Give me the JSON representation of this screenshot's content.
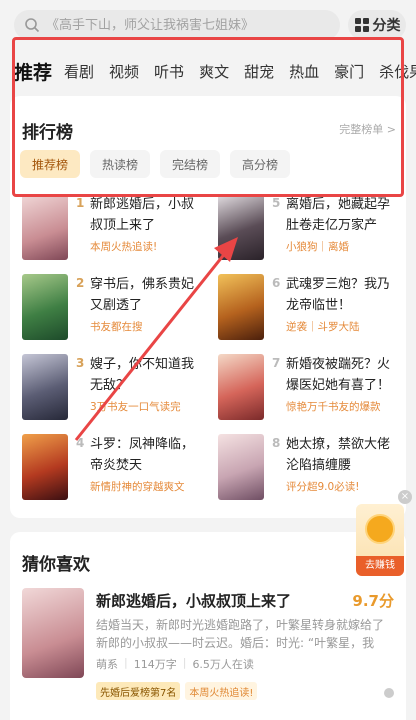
{
  "search": {
    "placeholder": "《高手下山，师父让我祸害七姐妹》"
  },
  "category_button": {
    "label": "分类"
  },
  "tabs": [
    "推荐",
    "看剧",
    "视频",
    "听书",
    "爽文",
    "甜宠",
    "热血",
    "豪门",
    "杀伐果"
  ],
  "ranking": {
    "title": "排行榜",
    "more": "完整榜单 >",
    "chips": [
      "推荐榜",
      "热读榜",
      "完结榜",
      "高分榜"
    ],
    "items": [
      {
        "rank": "1",
        "title": "新郎逃婚后，小叔叔顶上来了",
        "tag": "本周火热追读!"
      },
      {
        "rank": "5",
        "title": "离婚后，她藏起孕肚卷走亿万家产",
        "tag": "小狼狗｜离婚"
      },
      {
        "rank": "2",
        "title": "穿书后，佛系贵妃又剧透了",
        "tag": "书友都在搜"
      },
      {
        "rank": "6",
        "title": "武魂罗三炮？我乃龙帝临世！",
        "tag": "逆袭｜斗罗大陆"
      },
      {
        "rank": "3",
        "title": "嫂子，你不知道我无敌？",
        "tag": "3万书友一口气读完"
      },
      {
        "rank": "7",
        "title": "新婚夜被踹死？火爆医妃她有喜了！",
        "tag": "惊艳万千书友的爆款"
      },
      {
        "rank": "4",
        "title": "斗罗：凤神降临，帝炎焚天",
        "tag": "新情肘神的穿越爽文"
      },
      {
        "rank": "8",
        "title": "她太撩，禁欲大佬沦陷搞缠腰",
        "tag": "评分超9.0必读!"
      }
    ]
  },
  "guess": {
    "title": "猜你喜欢",
    "book": {
      "name": "新郎逃婚后，小叔叔顶上来了",
      "score": "9.7分",
      "desc": "结婚当天，新郎时光逃婚跑路了，叶繁星转身就嫁给了新郎的小叔叔——时云迟。婚后：时光: “叶繁星，我知…",
      "author": "萌系",
      "words": "114万字",
      "readers": "6.5万人在读",
      "tags": [
        "先婚后爱榜第7名",
        "本周火热追读!"
      ]
    }
  },
  "floating": {
    "label": "去赚钱"
  },
  "colors": {
    "accent": "#e99a2c",
    "chip_active_bg": "#fde9c2",
    "annotation_red": "#e94545"
  }
}
